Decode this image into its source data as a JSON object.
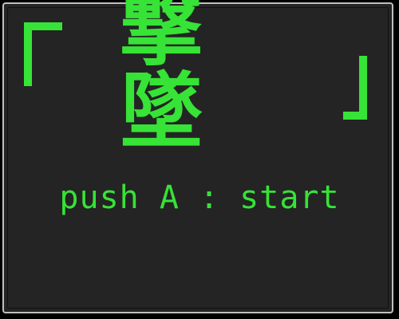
{
  "game": {
    "title_open_bracket": "「",
    "title_text": "撃墜",
    "title_close_bracket": "」",
    "prompt_text": "push A : start"
  },
  "colors": {
    "background": "#000000",
    "panel": "#242424",
    "border": "#bfbfbf",
    "text": "#36e336"
  },
  "icons": {
    "open_bracket": "corner-bracket-open-icon",
    "close_bracket": "corner-bracket-close-icon"
  }
}
